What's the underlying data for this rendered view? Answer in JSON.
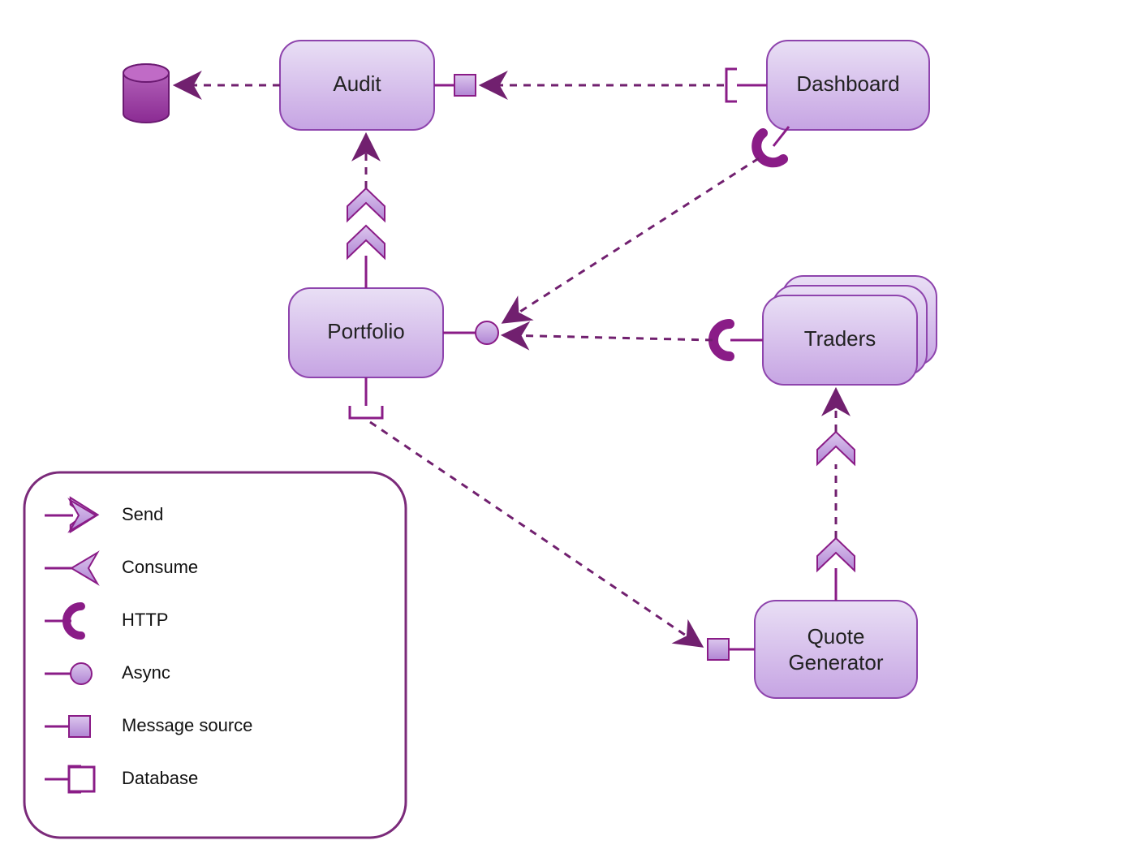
{
  "nodes": {
    "audit": "Audit",
    "dashboard": "Dashboard",
    "portfolio": "Portfolio",
    "traders": "Traders",
    "quoteGenerator": "Quote\nGenerator"
  },
  "legend": {
    "send": "Send",
    "consume": "Consume",
    "http": "HTTP",
    "async": "Async",
    "messageSource": "Message source",
    "database": "Database"
  },
  "chart_data": {
    "type": "diagram",
    "title": "",
    "nodes": [
      {
        "id": "audit",
        "label": "Audit",
        "kind": "component"
      },
      {
        "id": "dashboard",
        "label": "Dashboard",
        "kind": "component"
      },
      {
        "id": "portfolio",
        "label": "Portfolio",
        "kind": "component"
      },
      {
        "id": "traders",
        "label": "Traders",
        "kind": "component-stack"
      },
      {
        "id": "quoteGenerator",
        "label": "Quote Generator",
        "kind": "component"
      },
      {
        "id": "db",
        "label": "",
        "kind": "database"
      }
    ],
    "edges": [
      {
        "from": "dashboard",
        "to": "audit",
        "fromPort": "database",
        "toPort": "messageSource",
        "style": "dashed-arrow"
      },
      {
        "from": "audit",
        "to": "db",
        "style": "dashed-arrow"
      },
      {
        "from": "portfolio",
        "to": "audit",
        "style": "dashed-send-chevrons"
      },
      {
        "from": "dashboard",
        "to": "portfolio",
        "fromPort": "http",
        "toPort": "async",
        "style": "dashed-arrow"
      },
      {
        "from": "traders",
        "to": "portfolio",
        "fromPort": "http",
        "toPort": "async",
        "style": "dashed-arrow"
      },
      {
        "from": "quoteGenerator",
        "to": "traders",
        "style": "dashed-send-chevrons"
      },
      {
        "from": "portfolio",
        "to": "quoteGenerator",
        "fromPort": "database",
        "toPort": "messageSource",
        "style": "dashed-arrow"
      }
    ],
    "legend": [
      {
        "symbol": "send",
        "label": "Send"
      },
      {
        "symbol": "consume",
        "label": "Consume"
      },
      {
        "symbol": "http",
        "label": "HTTP"
      },
      {
        "symbol": "async",
        "label": "Async"
      },
      {
        "symbol": "messageSource",
        "label": "Message source"
      },
      {
        "symbol": "database",
        "label": "Database"
      }
    ]
  }
}
